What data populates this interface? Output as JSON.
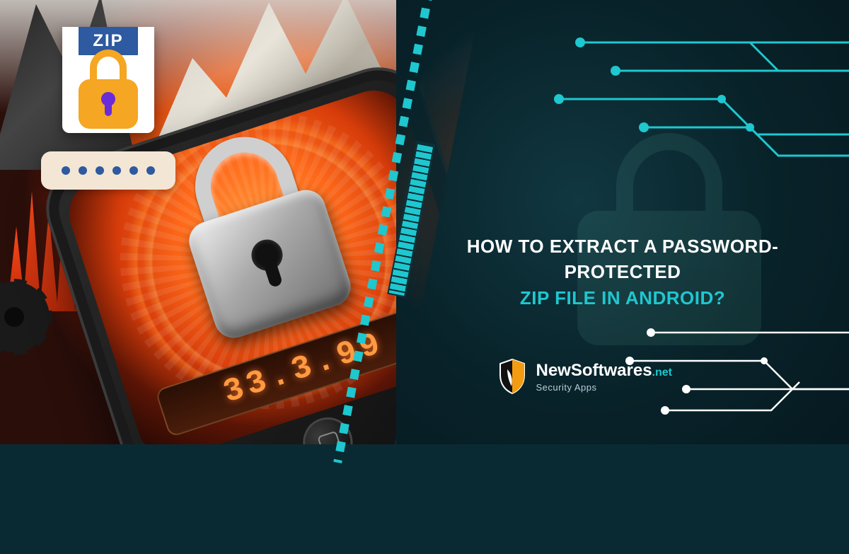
{
  "zip_badge": {
    "label": "ZIP",
    "password_dots": 6
  },
  "phone": {
    "digits": "33.3.99"
  },
  "headline": {
    "line1": "HOW TO EXTRACT A PASSWORD-PROTECTED",
    "line2": "ZIP FILE IN ANDROID?"
  },
  "brand": {
    "name_main": "NewSoftwares",
    "name_suffix": ".net",
    "tagline": "Security Apps"
  },
  "colors": {
    "accent": "#1fc7cf",
    "dark_bg": "#082229",
    "orange": "#ff7a1a",
    "zip_blue": "#2d5aa0",
    "zip_lock": "#f5a623"
  }
}
